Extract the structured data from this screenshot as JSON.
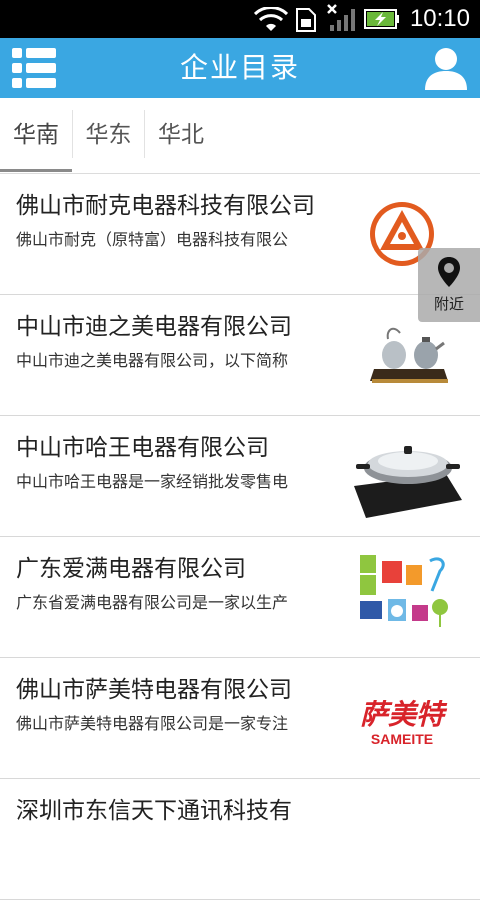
{
  "status_bar": {
    "time": "10:10"
  },
  "app_bar": {
    "title": "企业目录"
  },
  "tabs": [
    {
      "label": "华南"
    },
    {
      "label": "华东"
    },
    {
      "label": "华北"
    }
  ],
  "nearby": {
    "label": "附近"
  },
  "companies": [
    {
      "title": "佛山市耐克电器科技有限公司",
      "desc": "佛山市耐克（原特富）电器科技有限公",
      "thumb": "nike-logo"
    },
    {
      "title": "中山市迪之美电器有限公司",
      "desc": "中山市迪之美电器有限公司，以下简称",
      "thumb": "kettle-set"
    },
    {
      "title": "中山市哈王电器有限公司",
      "desc": "中山市哈王电器是一家经销批发零售电",
      "thumb": "hotpot"
    },
    {
      "title": "广东爱满电器有限公司",
      "desc": "广东省爱满电器有限公司是一家以生产",
      "thumb": "appliances"
    },
    {
      "title": "佛山市萨美特电器有限公司",
      "desc": "佛山市萨美特电器有限公司是一家专注",
      "thumb": "sameite-logo",
      "logo_cn": "萨美特",
      "logo_en": "SAMEITE"
    },
    {
      "title": "深圳市东信天下通讯科技有",
      "desc": "",
      "thumb": ""
    }
  ],
  "colors": {
    "app_bar": "#3aa7e2",
    "status_bar": "#000000",
    "logo_orange": "#e25b1f",
    "sameite_red": "#d8232a"
  }
}
